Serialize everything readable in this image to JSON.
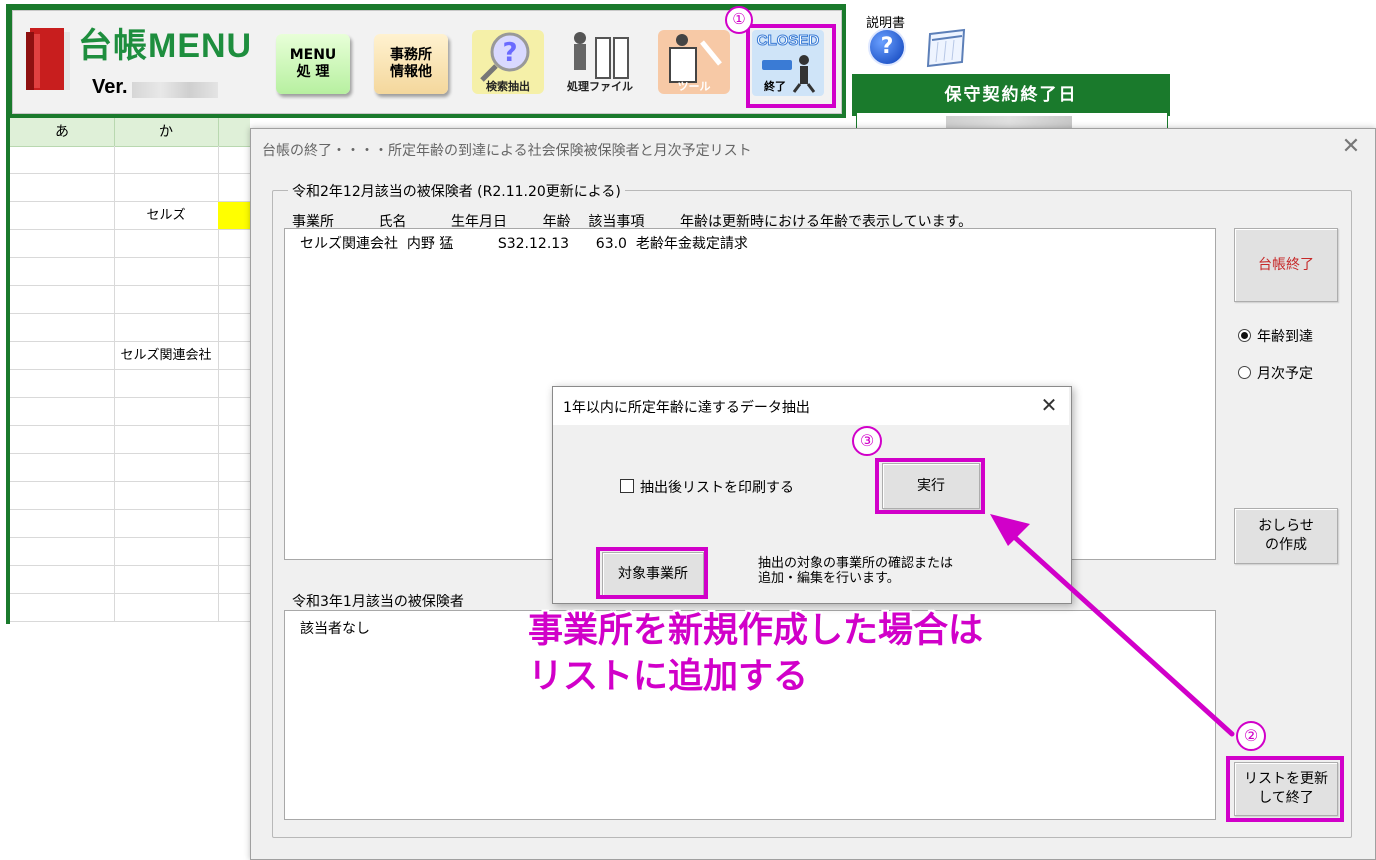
{
  "header": {
    "title": "台帳MENU",
    "version_label": "Ver.",
    "buttons": {
      "menu": "MENU\n処 理",
      "office": "事務所\n情報他",
      "search": "検索抽出",
      "files": "処理ファイル",
      "tools": "ツール",
      "closed_top": "CLOSED",
      "closed_bottom": "終了"
    },
    "manual_label": "説明書",
    "help_glyph": "?",
    "maintenance_label": "保守契約終了日"
  },
  "sheet": {
    "columns": [
      "あ",
      "か"
    ],
    "rows": [
      {
        "a": "",
        "ka": ""
      },
      {
        "a": "",
        "ka": ""
      },
      {
        "a": "",
        "ka": "セルズ"
      },
      {
        "a": "",
        "ka": ""
      },
      {
        "a": "",
        "ka": ""
      },
      {
        "a": "",
        "ka": ""
      },
      {
        "a": "",
        "ka": ""
      },
      {
        "a": "",
        "ka": "セルズ関連会社"
      },
      {
        "a": "",
        "ka": ""
      },
      {
        "a": "",
        "ka": ""
      },
      {
        "a": "",
        "ka": ""
      },
      {
        "a": "",
        "ka": ""
      },
      {
        "a": "",
        "ka": ""
      },
      {
        "a": "",
        "ka": ""
      },
      {
        "a": "",
        "ka": ""
      },
      {
        "a": "",
        "ka": ""
      },
      {
        "a": "",
        "ka": ""
      }
    ],
    "highlight_color": "#ffff00"
  },
  "dialog": {
    "title": "台帳の終了・・・・所定年齢の到達による社会保険被保険者と月次予定リスト",
    "close_glyph": "✕",
    "group_label": "令和2年12月該当の被保険者 (R2.11.20更新による)",
    "col_headers": "事業所          氏名          生年月日        年齢    該当事項        年齢は更新時における年齢で表示しています。",
    "list1_row": "セルズ関連会社  内野 猛          S32.12.13      63.0  老齢年金裁定請求",
    "list2_label": "令和3年1月該当の被保険者",
    "list2_row": "該当者なし",
    "btn_end": "台帳終了",
    "radio_age": "年齢到達",
    "radio_monthly": "月次予定",
    "btn_notice": "おしらせ\nの作成",
    "btn_update": "リストを更新\nして終了"
  },
  "subdialog": {
    "title": "1年以内に所定年齢に達するデータ抽出",
    "close_glyph": "✕",
    "print_checkbox": "抽出後リストを印刷する",
    "exec_button": "実行",
    "target_button": "対象事業所",
    "target_desc_1": "抽出の対象の事業所の確認または",
    "target_desc_2": "追加・編集を行います。"
  },
  "annotations": {
    "n1": "①",
    "n2": "②",
    "n3": "③",
    "note_line1": "事業所を新規作成した場合は",
    "note_line2": "リストに追加する",
    "color": "#d100c9"
  }
}
